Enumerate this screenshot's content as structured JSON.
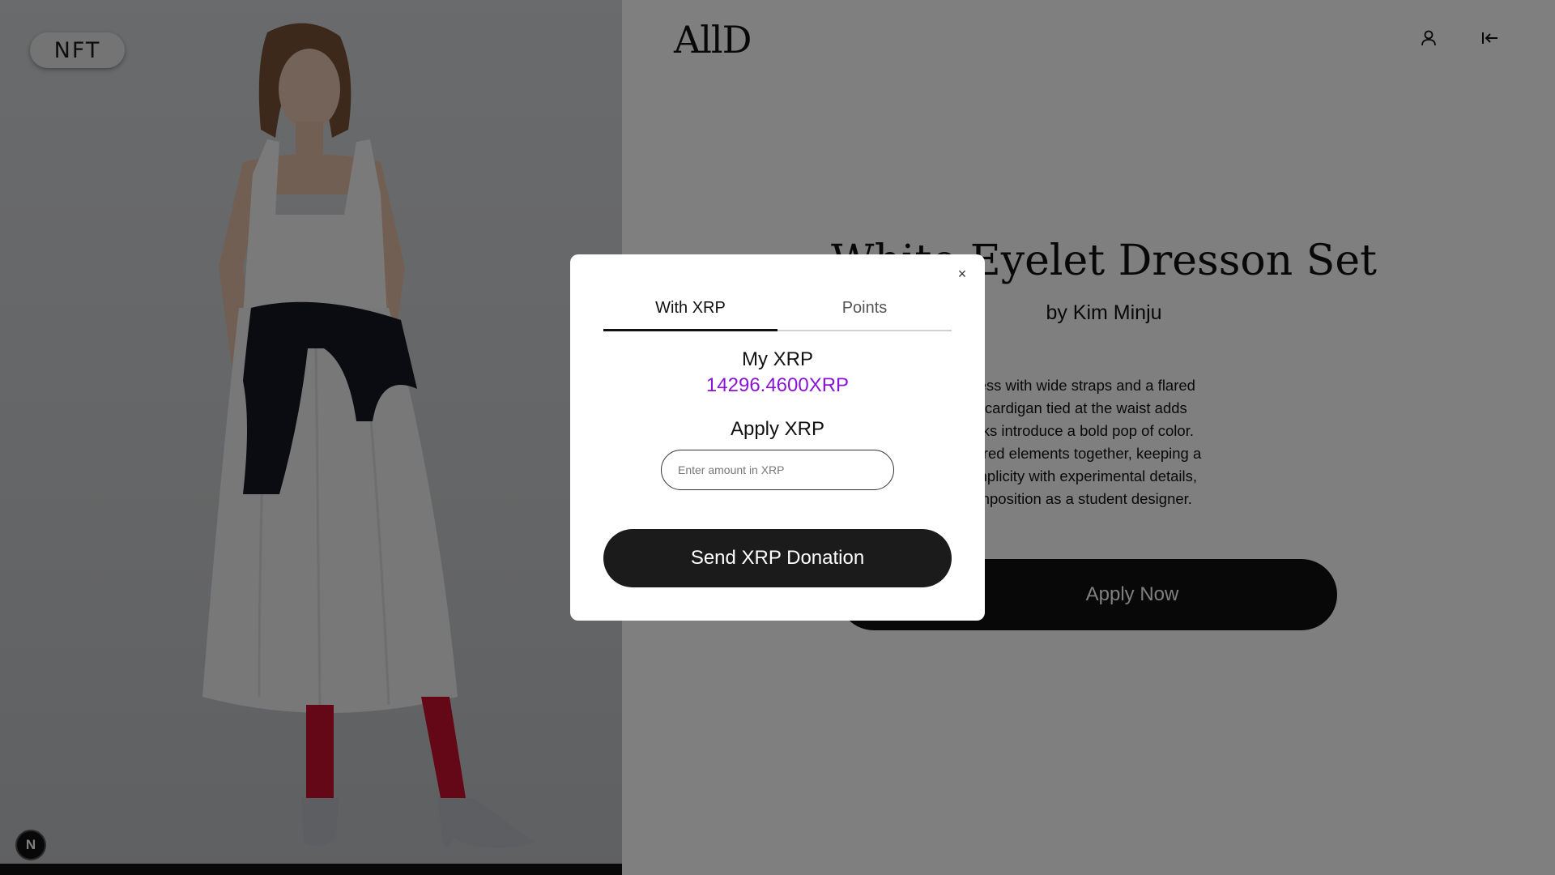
{
  "nft_badge": "NFT",
  "n_badge": "N",
  "header": {
    "logo": "AllD",
    "user_icon": "user-icon",
    "collapse_icon": "collapse-left-icon"
  },
  "product": {
    "title": "White Eyelet Dresson Set",
    "author": "by Kim Minju",
    "description_lines": [
      "a minimalist white dress with wide straps and a flared",
      ", neat shape. A black cardigan tied at the waist adds",
      "l touch, while red socks introduce a bold pop of color.",
      " the black, white, and red elements together, keeping a",
      "he outfit balances simplicity with experimental details,",
      "ation of color and composition as a student designer."
    ],
    "apply_button": "Apply Now"
  },
  "modal": {
    "close_label": "×",
    "tabs": [
      {
        "label": "With XRP",
        "active": true
      },
      {
        "label": "Points",
        "active": false
      }
    ],
    "my_xrp_label": "My XRP",
    "my_xrp_value": "14296.4600XRP",
    "apply_xrp_label": "Apply XRP",
    "input_placeholder": "Enter amount in XRP",
    "input_value": "",
    "send_button": "Send XRP Donation"
  },
  "colors": {
    "accent_purple": "#8a14d6",
    "button_dark": "#1b1b1b",
    "overlay": "rgba(0,0,0,0.5)"
  }
}
